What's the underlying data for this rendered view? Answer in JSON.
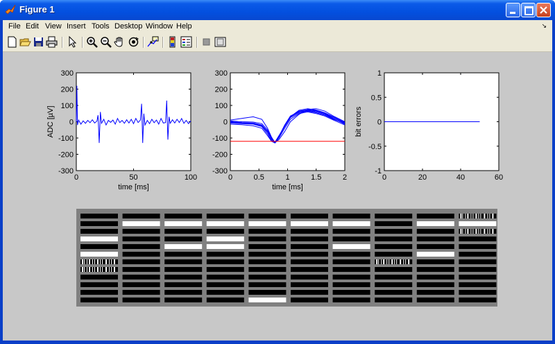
{
  "window": {
    "title": "Figure 1"
  },
  "menu": [
    "File",
    "Edit",
    "View",
    "Insert",
    "Tools",
    "Desktop",
    "Window",
    "Help"
  ],
  "toolbar": [
    "new-figure",
    "open-file",
    "save-figure",
    "print-figure",
    "edit-plot",
    "zoom-in",
    "zoom-out",
    "pan",
    "rotate-3d",
    "data-cursor",
    "insert-colorbar",
    "insert-legend",
    "hide-plot-tools",
    "show-plot-tools"
  ],
  "chart_data": [
    {
      "type": "line",
      "xlabel": "time [ms]",
      "ylabel": "ADC [µV]",
      "xlim": [
        0,
        100
      ],
      "ylim": [
        -300,
        300
      ],
      "xticks": [
        "0",
        "50",
        "100"
      ],
      "yticks": [
        "300",
        "200",
        "100",
        "0",
        "-100",
        "-200",
        "-300"
      ],
      "series": [
        {
          "color": "#0000ff",
          "x": [
            0,
            0.5,
            1,
            2,
            4,
            6,
            8,
            10,
            12,
            14,
            16,
            18,
            19,
            20,
            21,
            22,
            24,
            26,
            28,
            30,
            32,
            34,
            36,
            38,
            40,
            42,
            44,
            46,
            48,
            50,
            52,
            54,
            56,
            57,
            58,
            59,
            60,
            62,
            64,
            66,
            68,
            70,
            72,
            74,
            76,
            78,
            79,
            80,
            81,
            82,
            84,
            86,
            88,
            90,
            92,
            94,
            96,
            98,
            100
          ],
          "y": [
            0,
            220,
            -20,
            10,
            -15,
            5,
            -10,
            8,
            -6,
            12,
            -8,
            4,
            40,
            -130,
            60,
            -10,
            15,
            -20,
            8,
            -4,
            10,
            -15,
            20,
            -5,
            8,
            -10,
            12,
            -8,
            15,
            -12,
            20,
            -5,
            10,
            110,
            -130,
            50,
            -20,
            8,
            -12,
            15,
            -6,
            10,
            -15,
            20,
            -8,
            -5,
            130,
            -110,
            30,
            -10,
            12,
            -8,
            15,
            -5,
            20,
            -10,
            8,
            -12,
            5
          ]
        }
      ]
    },
    {
      "type": "line",
      "xlabel": "time [ms]",
      "ylabel": "",
      "xlim": [
        0,
        2
      ],
      "ylim": [
        -300,
        300
      ],
      "xticks": [
        "0",
        "0.5",
        "1",
        "1.5",
        "2"
      ],
      "yticks": [
        "300",
        "200",
        "100",
        "0",
        "-100",
        "-200",
        "-300"
      ],
      "series": [
        {
          "color": "#0000ff",
          "x": [
            0,
            0.2,
            0.4,
            0.55,
            0.65,
            0.72,
            0.78,
            0.85,
            0.95,
            1.05,
            1.2,
            1.35,
            1.5,
            1.65,
            1.8,
            2.0
          ],
          "y": [
            0,
            -5,
            -8,
            -20,
            -60,
            -110,
            -130,
            -95,
            -25,
            30,
            70,
            80,
            72,
            55,
            30,
            -5
          ]
        },
        {
          "color": "#0000ff",
          "x": [
            0,
            0.2,
            0.4,
            0.55,
            0.65,
            0.72,
            0.78,
            0.85,
            0.95,
            1.05,
            1.2,
            1.35,
            1.5,
            1.65,
            1.8,
            2.0
          ],
          "y": [
            -8,
            -12,
            -15,
            -30,
            -75,
            -118,
            -128,
            -90,
            -20,
            35,
            62,
            70,
            65,
            50,
            20,
            -15
          ]
        },
        {
          "color": "#0000ff",
          "x": [
            0,
            0.2,
            0.4,
            0.55,
            0.65,
            0.72,
            0.78,
            0.85,
            0.95,
            1.05,
            1.2,
            1.35,
            1.5,
            1.65,
            1.8,
            2.0
          ],
          "y": [
            5,
            0,
            -2,
            -12,
            -50,
            -100,
            -125,
            -85,
            -30,
            25,
            55,
            65,
            55,
            40,
            15,
            -10
          ]
        },
        {
          "color": "#0000ff",
          "x": [
            0,
            0.2,
            0.4,
            0.55,
            0.65,
            0.72,
            0.78,
            0.85,
            0.95,
            1.05,
            1.2,
            1.35,
            1.5,
            1.65,
            1.8,
            2.0
          ],
          "y": [
            -15,
            -18,
            -25,
            -40,
            -85,
            -120,
            -130,
            -100,
            -40,
            15,
            50,
            60,
            50,
            35,
            10,
            -20
          ]
        },
        {
          "color": "#0000ff",
          "x": [
            0,
            0.2,
            0.4,
            0.55,
            0.65,
            0.72,
            0.78,
            0.85,
            0.95,
            1.05,
            1.2,
            1.35,
            1.5,
            1.65,
            1.8,
            2.0
          ],
          "y": [
            10,
            20,
            30,
            15,
            -40,
            -95,
            -128,
            -110,
            -60,
            0,
            45,
            75,
            80,
            65,
            35,
            0
          ]
        },
        {
          "color": "#0000ff",
          "x": [
            0,
            0.2,
            0.4,
            0.55,
            0.65,
            0.72,
            0.78,
            0.85,
            0.95,
            1.05,
            1.2,
            1.35,
            1.5,
            1.65,
            1.8,
            2.0
          ],
          "y": [
            -3,
            -10,
            -12,
            -25,
            -65,
            -108,
            -127,
            -92,
            -28,
            28,
            65,
            74,
            68,
            52,
            25,
            -8
          ]
        },
        {
          "color": "#0000ff",
          "x": [
            0,
            0.2,
            0.4,
            0.55,
            0.65,
            0.72,
            0.78,
            0.85,
            0.95,
            1.05,
            1.2,
            1.35,
            1.5,
            1.65,
            1.8,
            2.0
          ],
          "y": [
            0,
            -6,
            -10,
            -22,
            -58,
            -105,
            -126,
            -88,
            -22,
            32,
            60,
            68,
            60,
            45,
            18,
            -12
          ]
        },
        {
          "color": "#ff0000",
          "x": [
            0,
            2
          ],
          "y": [
            -120,
            -120
          ]
        }
      ]
    },
    {
      "type": "line",
      "xlabel": "",
      "ylabel": "bit errors",
      "xlim": [
        0,
        60
      ],
      "ylim": [
        -1,
        1
      ],
      "xticks": [
        "0",
        "20",
        "40",
        "60"
      ],
      "yticks": [
        "1",
        "0.5",
        "0",
        "-0.5",
        "-1"
      ],
      "series": [
        {
          "color": "#0000ff",
          "x": [
            0,
            50
          ],
          "y": [
            0,
            0
          ]
        }
      ]
    }
  ],
  "bit_grid": {
    "rows": 12,
    "columns": 10,
    "white_cells": [
      [
        1,
        1
      ],
      [
        1,
        2
      ],
      [
        1,
        3
      ],
      [
        1,
        4
      ],
      [
        1,
        5
      ],
      [
        1,
        6
      ],
      [
        1,
        8
      ],
      [
        1,
        9
      ],
      [
        3,
        0
      ],
      [
        3,
        3
      ],
      [
        4,
        2
      ],
      [
        4,
        3
      ],
      [
        4,
        6
      ],
      [
        5,
        0
      ],
      [
        5,
        8
      ],
      [
        11,
        4
      ]
    ],
    "patterned_cells": [
      [
        0,
        9
      ],
      [
        2,
        9
      ],
      [
        6,
        0
      ],
      [
        6,
        7
      ],
      [
        7,
        0
      ]
    ]
  }
}
